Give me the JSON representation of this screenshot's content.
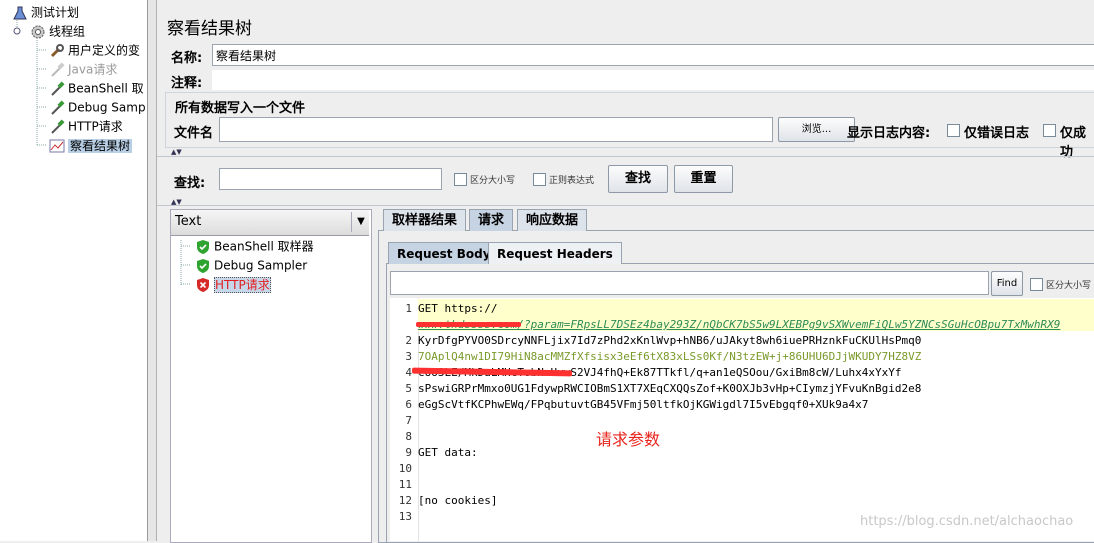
{
  "tree": {
    "items": [
      {
        "label": "测试计划",
        "icon": "test-plan-icon"
      },
      {
        "label": "线程组",
        "icon": "gear-icon"
      },
      {
        "label": "用户定义的变",
        "icon": "wrench-icon"
      },
      {
        "label": "Java请求",
        "icon": "pipette-icon"
      },
      {
        "label": "BeanShell 取",
        "icon": "pipette-icon"
      },
      {
        "label": "Debug Samp",
        "icon": "pipette-icon"
      },
      {
        "label": "HTTP请求",
        "icon": "pipette-icon"
      },
      {
        "label": "察看结果树",
        "icon": "graph-icon"
      }
    ]
  },
  "panel": {
    "title": "察看结果树",
    "name_label": "名称:",
    "name_value": "察看结果树",
    "comment_label": "注释:",
    "file_section_title": "所有数据写入一个文件",
    "file_label": "文件名",
    "browse_label": "浏览...",
    "log_label": "显示日志内容:",
    "errors_only_label": "仅错误日志",
    "success_only_label": "仅成功"
  },
  "search": {
    "label": "查找:",
    "case_label": "区分大小写",
    "regex_label": "正则表达式",
    "find_button": "查找",
    "reset_button": "重置"
  },
  "results": {
    "renderer": "Text",
    "samples": [
      {
        "label": "BeanShell 取样器",
        "status": "success"
      },
      {
        "label": "Debug Sampler",
        "status": "success"
      },
      {
        "label": "HTTP请求",
        "status": "error"
      }
    ]
  },
  "tabs": {
    "main": [
      "取样器结果",
      "请求",
      "响应数据"
    ],
    "active_main": "请求",
    "sub": [
      "Request Body",
      "Request Headers"
    ],
    "active_sub": "Request Body"
  },
  "request_find": {
    "button": "Find",
    "case_label": "区分大小写"
  },
  "code_lines": [
    {
      "n": "1",
      "text": "GET https://"
    },
    {
      "n": "",
      "text": "www.thdssss.com/?param=FRpsLL7DSEz4bay293Z/nQbCK7bS5w9LXEBPg9vSXWvemFiQLw5YZNCsSGuHcOBpu7TxMwhRX9"
    },
    {
      "n": "2",
      "text": "KyrDfgPYVO0SDrcyNNFLjix7Id7zPhd2xKnlWvp+hNB6/uJAkyt8wh6iuePRHznkFuCKUlHsPmq0"
    },
    {
      "n": "3",
      "text": "7OAplQ4nw1DI79HiN8acMMZfXfsisx3eEf6tX83xLSs0Kf/N3tzEW+j+86UHU6DJjWKUDY7HZ8VZ"
    },
    {
      "n": "4",
      "text": "cUo3LE/MkDaLMHcTobNmUvwS2VJ4fhQ+Ek87TTkfl/q+an1eQSOou/GxiBm8cW/Luhx4xYxYf"
    },
    {
      "n": "5",
      "text": "sPswiGRPrMmxo0UG1FdywpRWCIOBmS1XT7XEqCXQQsZof+K0OXJb3vHp+CIymzjYFvuKnBgid2e8"
    },
    {
      "n": "6",
      "text": "eGgScVtfKCPhwEWq/FPqbutuvtGB45VFmj50ltfkOjKGWigdl7I5vEbgqf0+XUk9a4x7"
    },
    {
      "n": "7",
      "text": ""
    },
    {
      "n": "8",
      "text": ""
    },
    {
      "n": "9",
      "text": "GET data:"
    },
    {
      "n": "10",
      "text": ""
    },
    {
      "n": "11",
      "text": ""
    },
    {
      "n": "12",
      "text": "[no cookies]"
    },
    {
      "n": "13",
      "text": ""
    }
  ],
  "annotation": "请求参数",
  "watermark": "https://blog.csdn.net/alchaochao",
  "colors": {
    "highlight_line": "#ffffcc",
    "url_green": "#2e8b57",
    "redaction": "#ff3030",
    "annotation": "#e8241b",
    "error_label": "#e02020",
    "selection": "#b8cfe5"
  }
}
